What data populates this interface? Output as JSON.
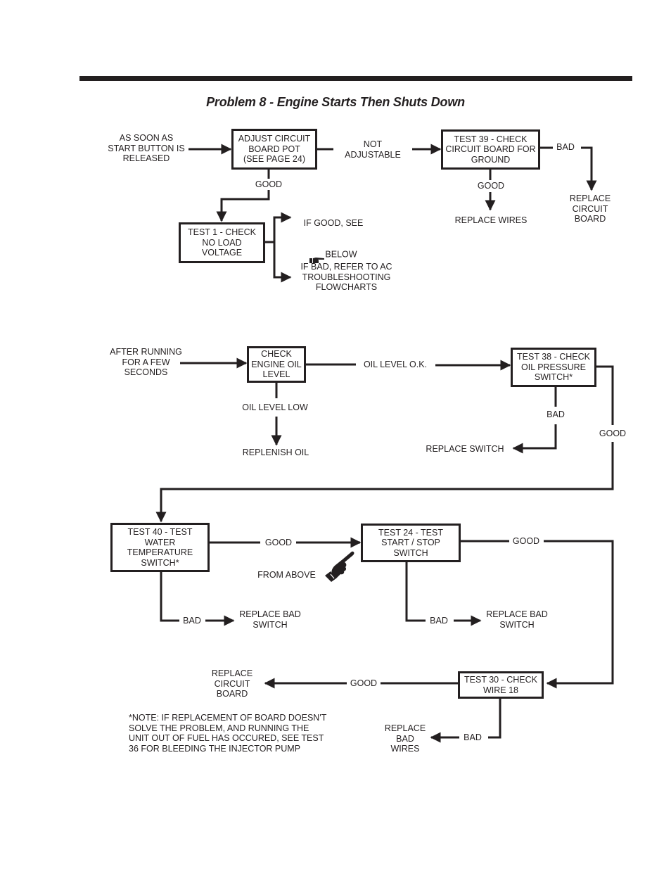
{
  "page": {
    "title": "Problem 8 - Engine Starts Then Shuts Down"
  },
  "flowchart": {
    "section1": {
      "start": "AS SOON AS\nSTART BUTTON IS\nRELEASED",
      "adjust_pot": "ADJUST CIRCUIT\nBOARD POT\n(SEE PAGE 24)",
      "not_adjustable": "NOT\nADJUSTABLE",
      "test39": "TEST 39 - CHECK\nCIRCUIT BOARD FOR\nGROUND",
      "test39_bad": "BAD",
      "replace_board": "REPLACE\nCIRCUIT\nBOARD",
      "test39_good": "GOOD",
      "replace_wires": "REPLACE WIRES",
      "pot_good": "GOOD",
      "test1": "TEST 1 - CHECK\nNO LOAD\nVOLTAGE",
      "if_good_line1": "IF GOOD,  SEE",
      "if_good_line2": "BELOW",
      "if_bad": "IF BAD, REFER TO AC\nTROUBLESHOOTING\nFLOWCHARTS"
    },
    "section2": {
      "start": "AFTER RUNNING\nFOR A FEW\nSECONDS",
      "check_oil": "CHECK\nENGINE OIL\nLEVEL",
      "oil_ok": "OIL LEVEL O.K.",
      "oil_low": "OIL LEVEL LOW",
      "replenish": "REPLENISH OIL",
      "test38": "TEST 38 - CHECK\nOIL PRESSURE\nSWITCH*",
      "test38_bad": "BAD",
      "replace_switch": "REPLACE SWITCH",
      "test38_good": "GOOD",
      "test40": "TEST 40 - TEST\nWATER\nTEMPERATURE\nSWITCH*",
      "test40_good": "GOOD",
      "from_above": "FROM ABOVE",
      "test40_bad": "BAD",
      "replace_bad_switch_1": "REPLACE BAD\nSWITCH",
      "test24": "TEST 24 - TEST\nSTART / STOP\nSWITCH",
      "test24_good": "GOOD",
      "test24_bad": "BAD",
      "replace_bad_switch_2": "REPLACE BAD\nSWITCH",
      "test30": "TEST 30 - CHECK\nWIRE 18",
      "test30_good": "GOOD",
      "replace_board": "REPLACE\nCIRCUIT\nBOARD",
      "test30_bad": "BAD",
      "replace_bad_wires": "REPLACE\nBAD\nWIRES"
    },
    "note": "*NOTE: IF REPLACEMENT OF BOARD DOESN'T\nSOLVE THE PROBLEM, AND RUNNING THE\nUNIT OUT OF FUEL HAS OCCURED, SEE TEST\n36 FOR BLEEDING THE INJECTOR PUMP"
  },
  "icons": {
    "pointing_hand": "pointing-hand-icon"
  }
}
